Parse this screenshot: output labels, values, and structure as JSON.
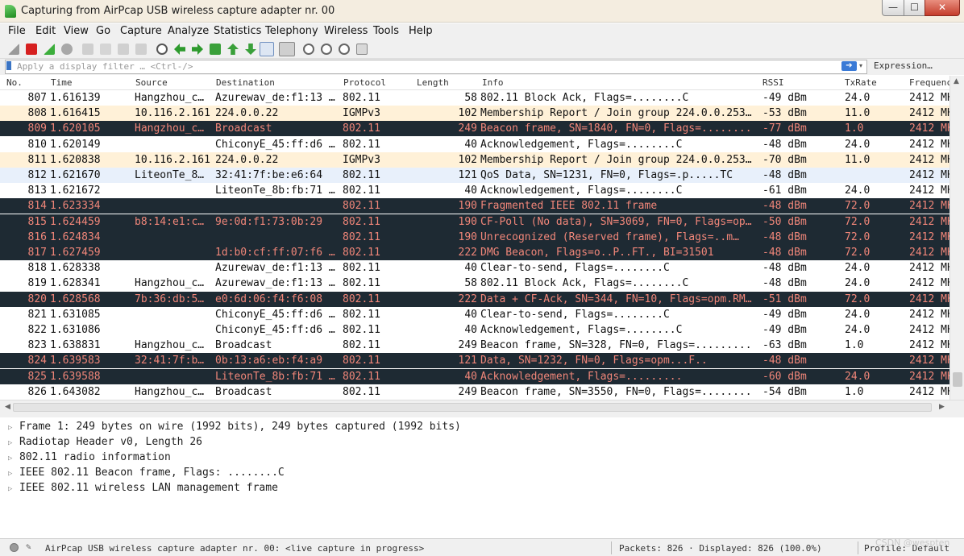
{
  "window": {
    "title": "Capturing from AirPcap USB wireless capture adapter nr. 00"
  },
  "window_controls": {
    "minimize": "—",
    "maximize": "☐",
    "close": "✕"
  },
  "menu": [
    "File",
    "Edit",
    "View",
    "Go",
    "Capture",
    "Analyze",
    "Statistics",
    "Telephony",
    "Wireless",
    "Tools",
    "Help"
  ],
  "filter": {
    "placeholder": "Apply a display filter … <Ctrl-/>",
    "apply": "➔",
    "dropdown": "▾",
    "expression": "Expression…"
  },
  "columns": [
    "No.",
    "Time",
    "Source",
    "Destination",
    "Protocol",
    "Length",
    "Info",
    "RSSI",
    "TxRate",
    "Frequency"
  ],
  "colors": {
    "dark_row_bg": "#1e2a33",
    "dark_row_text": "#f08679",
    "igmp_row_bg": "#fff1d8"
  },
  "packets": [
    {
      "style": "normal",
      "no": "807",
      "time": "1.616139",
      "src": "Hangzhou_c…",
      "dst": "Azurewav_de:f1:13 …",
      "proto": "802.11",
      "len": "58",
      "info": "802.11 Block Ack, Flags=........C",
      "rssi": "-49 dBm",
      "txrate": "24.0",
      "freq": "2412 MH"
    },
    {
      "style": "igmp",
      "no": "808",
      "time": "1.616415",
      "src": "10.116.2.161",
      "dst": "224.0.0.22",
      "proto": "IGMPv3",
      "len": "102",
      "info": "Membership Report / Join group 224.0.0.253…",
      "rssi": "-53 dBm",
      "txrate": "11.0",
      "freq": "2412 MH"
    },
    {
      "style": "dark",
      "no": "809",
      "time": "1.620105",
      "src": "Hangzhou_c…",
      "dst": "Broadcast",
      "proto": "802.11",
      "len": "249",
      "info": "Beacon frame, SN=1840, FN=0, Flags=........",
      "rssi": "-77 dBm",
      "txrate": "1.0",
      "freq": "2412 MH"
    },
    {
      "style": "normal",
      "no": "810",
      "time": "1.620149",
      "src": "",
      "dst": "ChiconyE_45:ff:d6 …",
      "proto": "802.11",
      "len": "40",
      "info": "Acknowledgement, Flags=........C",
      "rssi": "-48 dBm",
      "txrate": "24.0",
      "freq": "2412 MH"
    },
    {
      "style": "igmp",
      "no": "811",
      "time": "1.620838",
      "src": "10.116.2.161",
      "dst": "224.0.0.22",
      "proto": "IGMPv3",
      "len": "102",
      "info": "Membership Report / Join group 224.0.0.253…",
      "rssi": "-70 dBm",
      "txrate": "11.0",
      "freq": "2412 MH"
    },
    {
      "style": "sel",
      "no": "812",
      "time": "1.621670",
      "src": "LiteonTe_8…",
      "dst": "32:41:7f:be:e6:64",
      "proto": "802.11",
      "len": "121",
      "info": "QoS Data, SN=1231, FN=0, Flags=.p.....TC",
      "rssi": "-48 dBm",
      "txrate": "",
      "freq": "2412 MH"
    },
    {
      "style": "normal",
      "no": "813",
      "time": "1.621672",
      "src": "",
      "dst": "LiteonTe_8b:fb:71 …",
      "proto": "802.11",
      "len": "40",
      "info": "Acknowledgement, Flags=........C",
      "rssi": "-61 dBm",
      "txrate": "24.0",
      "freq": "2412 MH"
    },
    {
      "style": "dark",
      "no": "814",
      "time": "1.623334",
      "src": "",
      "dst": "",
      "proto": "802.11",
      "len": "190",
      "info": "Fragmented IEEE 802.11 frame",
      "rssi": "-48 dBm",
      "txrate": "72.0",
      "freq": "2412 MH"
    },
    {
      "style": "dark",
      "no": "815",
      "time": "1.624459",
      "src": "b8:14:e1:c…",
      "dst": "9e:0d:f1:73:0b:29",
      "proto": "802.11",
      "len": "190",
      "info": "CF-Poll (No data), SN=3069, FN=0, Flags=op…",
      "rssi": "-50 dBm",
      "txrate": "72.0",
      "freq": "2412 MH"
    },
    {
      "style": "dark",
      "no": "816",
      "time": "1.624834",
      "src": "",
      "dst": "",
      "proto": "802.11",
      "len": "190",
      "info": "Unrecognized (Reserved frame), Flags=..m…",
      "rssi": "-48 dBm",
      "txrate": "72.0",
      "freq": "2412 MH"
    },
    {
      "style": "dark",
      "no": "817",
      "time": "1.627459",
      "src": "",
      "dst": "1d:b0:cf:ff:07:f6 …",
      "proto": "802.11",
      "len": "222",
      "info": "DMG Beacon, Flags=o..P..FT., BI=31501",
      "rssi": "-48 dBm",
      "txrate": "72.0",
      "freq": "2412 MH"
    },
    {
      "style": "normal",
      "no": "818",
      "time": "1.628338",
      "src": "",
      "dst": "Azurewav_de:f1:13 …",
      "proto": "802.11",
      "len": "40",
      "info": "Clear-to-send, Flags=........C",
      "rssi": "-48 dBm",
      "txrate": "24.0",
      "freq": "2412 MH"
    },
    {
      "style": "normal",
      "no": "819",
      "time": "1.628341",
      "src": "Hangzhou_c…",
      "dst": "Azurewav_de:f1:13 …",
      "proto": "802.11",
      "len": "58",
      "info": "802.11 Block Ack, Flags=........C",
      "rssi": "-48 dBm",
      "txrate": "24.0",
      "freq": "2412 MH"
    },
    {
      "style": "dark",
      "no": "820",
      "time": "1.628568",
      "src": "7b:36:db:5…",
      "dst": "e0:6d:06:f4:f6:08",
      "proto": "802.11",
      "len": "222",
      "info": "Data + CF-Ack, SN=344, FN=10, Flags=opm.RM…",
      "rssi": "-51 dBm",
      "txrate": "72.0",
      "freq": "2412 MH"
    },
    {
      "style": "normal",
      "no": "821",
      "time": "1.631085",
      "src": "",
      "dst": "ChiconyE_45:ff:d6 …",
      "proto": "802.11",
      "len": "40",
      "info": "Clear-to-send, Flags=........C",
      "rssi": "-49 dBm",
      "txrate": "24.0",
      "freq": "2412 MH"
    },
    {
      "style": "normal",
      "no": "822",
      "time": "1.631086",
      "src": "",
      "dst": "ChiconyE_45:ff:d6 …",
      "proto": "802.11",
      "len": "40",
      "info": "Acknowledgement, Flags=........C",
      "rssi": "-49 dBm",
      "txrate": "24.0",
      "freq": "2412 MH"
    },
    {
      "style": "normal",
      "no": "823",
      "time": "1.638831",
      "src": "Hangzhou_c…",
      "dst": "Broadcast",
      "proto": "802.11",
      "len": "249",
      "info": "Beacon frame, SN=328, FN=0, Flags=.........",
      "rssi": "-63 dBm",
      "txrate": "1.0",
      "freq": "2412 MH"
    },
    {
      "style": "dark",
      "no": "824",
      "time": "1.639583",
      "src": "32:41:7f:b…",
      "dst": "0b:13:a6:eb:f4:a9",
      "proto": "802.11",
      "len": "121",
      "info": "Data, SN=1232, FN=0, Flags=opm...F..",
      "rssi": "-48 dBm",
      "txrate": "",
      "freq": "2412 MH"
    },
    {
      "style": "dark",
      "no": "825",
      "time": "1.639588",
      "src": "",
      "dst": "LiteonTe_8b:fb:71 …",
      "proto": "802.11",
      "len": "40",
      "info": "Acknowledgement, Flags=.........",
      "rssi": "-60 dBm",
      "txrate": "24.0",
      "freq": "2412 MH"
    },
    {
      "style": "normal",
      "no": "826",
      "time": "1.643082",
      "src": "Hangzhou_c…",
      "dst": "Broadcast",
      "proto": "802.11",
      "len": "249",
      "info": "Beacon frame, SN=3550, FN=0, Flags=........",
      "rssi": "-54 dBm",
      "txrate": "1.0",
      "freq": "2412 MH"
    }
  ],
  "details": [
    "Frame 1: 249 bytes on wire (1992 bits), 249 bytes captured (1992 bits)",
    "Radiotap Header v0, Length 26",
    "802.11 radio information",
    "IEEE 802.11 Beacon frame, Flags: ........C",
    "IEEE 802.11 wireless LAN management frame"
  ],
  "status": {
    "capture": "AirPcap USB wireless capture adapter nr. 00: <live capture in progress>",
    "packets": "Packets: 826 · Displayed: 826 (100.0%)",
    "profile": "Profile: Default"
  },
  "watermark": "CSDN @wespten"
}
